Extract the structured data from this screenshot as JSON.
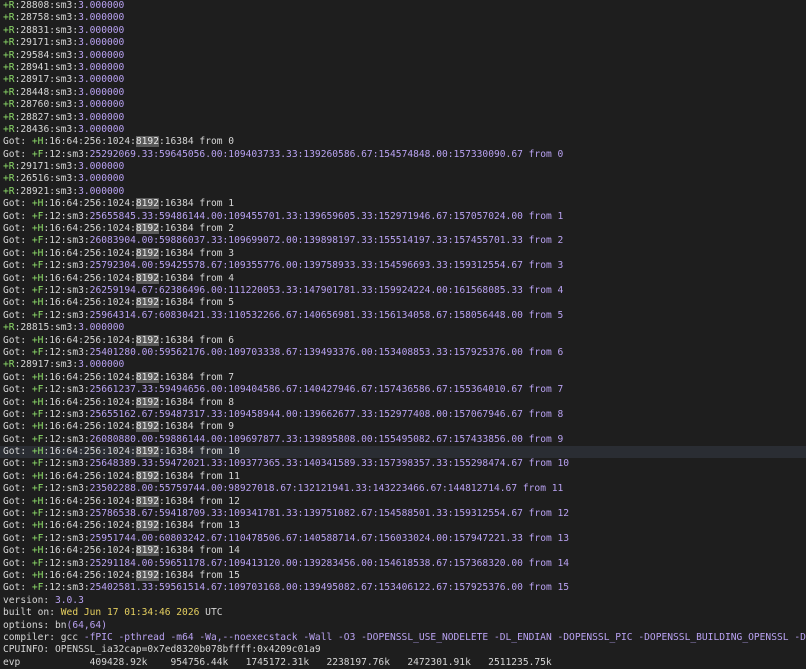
{
  "terminal": {
    "lines": [
      [
        [
          "g",
          "+R"
        ],
        [
          "w",
          ":28808:sm3:"
        ],
        [
          "p",
          "3.000000"
        ]
      ],
      [
        [
          "g",
          "+R"
        ],
        [
          "w",
          ":28758:sm3:"
        ],
        [
          "p",
          "3.000000"
        ]
      ],
      [
        [
          "g",
          "+R"
        ],
        [
          "w",
          ":28831:sm3:"
        ],
        [
          "p",
          "3.000000"
        ]
      ],
      [
        [
          "g",
          "+R"
        ],
        [
          "w",
          ":29171:sm3:"
        ],
        [
          "p",
          "3.000000"
        ]
      ],
      [
        [
          "g",
          "+R"
        ],
        [
          "w",
          ":29584:sm3:"
        ],
        [
          "p",
          "3.000000"
        ]
      ],
      [
        [
          "g",
          "+R"
        ],
        [
          "w",
          ":28941:sm3:"
        ],
        [
          "p",
          "3.000000"
        ]
      ],
      [
        [
          "g",
          "+R"
        ],
        [
          "w",
          ":28917:sm3:"
        ],
        [
          "p",
          "3.000000"
        ]
      ],
      [
        [
          "g",
          "+R"
        ],
        [
          "w",
          ":28448:sm3:"
        ],
        [
          "p",
          "3.000000"
        ]
      ],
      [
        [
          "g",
          "+R"
        ],
        [
          "w",
          ":28760:sm3:"
        ],
        [
          "p",
          "3.000000"
        ]
      ],
      [
        [
          "g",
          "+R"
        ],
        [
          "w",
          ":28827:sm3:"
        ],
        [
          "p",
          "3.000000"
        ]
      ],
      [
        [
          "g",
          "+R"
        ],
        [
          "w",
          ":28436:sm3:"
        ],
        [
          "p",
          "3.000000"
        ]
      ],
      [
        [
          "w",
          "Got: "
        ],
        [
          "g",
          "+H"
        ],
        [
          "w",
          ":16:64:256:1024:"
        ],
        [
          "s",
          "8192"
        ],
        [
          "w",
          ":16384 from 0"
        ]
      ],
      [
        [
          "w",
          "Got: "
        ],
        [
          "g",
          "+F"
        ],
        [
          "w",
          ":12:sm3:"
        ],
        [
          "p",
          "25292069.33:59645056.00:109403733.33:139260586.67:154574848.00:157330090.67 from 0"
        ]
      ],
      [
        [
          "g",
          "+R"
        ],
        [
          "w",
          ":29171:sm3:"
        ],
        [
          "p",
          "3.000000"
        ]
      ],
      [
        [
          "g",
          "+R"
        ],
        [
          "w",
          ":26516:sm3:"
        ],
        [
          "p",
          "3.000000"
        ]
      ],
      [
        [
          "g",
          "+R"
        ],
        [
          "w",
          ":28921:sm3:"
        ],
        [
          "p",
          "3.000000"
        ]
      ],
      [
        [
          "w",
          "Got: "
        ],
        [
          "g",
          "+H"
        ],
        [
          "w",
          ":16:64:256:1024:"
        ],
        [
          "s",
          "8192"
        ],
        [
          "w",
          ":16384 from 1"
        ]
      ],
      [
        [
          "w",
          "Got: "
        ],
        [
          "g",
          "+F"
        ],
        [
          "w",
          ":12:sm3:"
        ],
        [
          "p",
          "25655845.33:59486144.00:109455701.33:139659605.33:152971946.67:157057024.00 from 1"
        ]
      ],
      [
        [
          "w",
          "Got: "
        ],
        [
          "g",
          "+H"
        ],
        [
          "w",
          ":16:64:256:1024:"
        ],
        [
          "s",
          "8192"
        ],
        [
          "w",
          ":16384 from 2"
        ]
      ],
      [
        [
          "w",
          "Got: "
        ],
        [
          "g",
          "+F"
        ],
        [
          "w",
          ":12:sm3:"
        ],
        [
          "p",
          "26083904.00:59886037.33:109699072.00:139898197.33:155514197.33:157455701.33 from 2"
        ]
      ],
      [
        [
          "w",
          "Got: "
        ],
        [
          "g",
          "+H"
        ],
        [
          "w",
          ":16:64:256:1024:"
        ],
        [
          "s",
          "8192"
        ],
        [
          "w",
          ":16384 from 3"
        ]
      ],
      [
        [
          "w",
          "Got: "
        ],
        [
          "g",
          "+F"
        ],
        [
          "w",
          ":12:sm3:"
        ],
        [
          "p",
          "25792304.00:59425578.67:109355776.00:139758933.33:154596693.33:159312554.67 from 3"
        ]
      ],
      [
        [
          "w",
          "Got: "
        ],
        [
          "g",
          "+H"
        ],
        [
          "w",
          ":16:64:256:1024:"
        ],
        [
          "s",
          "8192"
        ],
        [
          "w",
          ":16384 from 4"
        ]
      ],
      [
        [
          "w",
          "Got: "
        ],
        [
          "g",
          "+F"
        ],
        [
          "w",
          ":12:sm3:"
        ],
        [
          "p",
          "26259194.67:62386496.00:111220053.33:147901781.33:159924224.00:161568085.33 from 4"
        ]
      ],
      [
        [
          "w",
          "Got: "
        ],
        [
          "g",
          "+H"
        ],
        [
          "w",
          ":16:64:256:1024:"
        ],
        [
          "s",
          "8192"
        ],
        [
          "w",
          ":16384 from 5"
        ]
      ],
      [
        [
          "w",
          "Got: "
        ],
        [
          "g",
          "+F"
        ],
        [
          "w",
          ":12:sm3:"
        ],
        [
          "p",
          "25964314.67:60830421.33:110532266.67:140656981.33:156134058.67:158056448.00 from 5"
        ]
      ],
      [
        [
          "g",
          "+R"
        ],
        [
          "w",
          ":28815:sm3:"
        ],
        [
          "p",
          "3.000000"
        ]
      ],
      [
        [
          "w",
          "Got: "
        ],
        [
          "g",
          "+H"
        ],
        [
          "w",
          ":16:64:256:1024:"
        ],
        [
          "s",
          "8192"
        ],
        [
          "w",
          ":16384 from 6"
        ]
      ],
      [
        [
          "w",
          "Got: "
        ],
        [
          "g",
          "+F"
        ],
        [
          "w",
          ":12:sm3:"
        ],
        [
          "p",
          "25401280.00:59562176.00:109703338.67:139493376.00:153408853.33:157925376.00 from 6"
        ]
      ],
      [
        [
          "g",
          "+R"
        ],
        [
          "w",
          ":28917:sm3:"
        ],
        [
          "p",
          "3.000000"
        ]
      ],
      [
        [
          "w",
          "Got: "
        ],
        [
          "g",
          "+H"
        ],
        [
          "w",
          ":16:64:256:1024:"
        ],
        [
          "s",
          "8192"
        ],
        [
          "w",
          ":16384 from 7"
        ]
      ],
      [
        [
          "w",
          "Got: "
        ],
        [
          "g",
          "+F"
        ],
        [
          "w",
          ":12:sm3:"
        ],
        [
          "p",
          "25661237.33:59494656.00:109404586.67:140427946.67:157436586.67:155364010.67 from 7"
        ]
      ],
      [
        [
          "w",
          "Got: "
        ],
        [
          "g",
          "+H"
        ],
        [
          "w",
          ":16:64:256:1024:"
        ],
        [
          "s",
          "8192"
        ],
        [
          "w",
          ":16384 from 8"
        ]
      ],
      [
        [
          "w",
          "Got: "
        ],
        [
          "g",
          "+F"
        ],
        [
          "w",
          ":12:sm3:"
        ],
        [
          "p",
          "25655162.67:59487317.33:109458944.00:139662677.33:152977408.00:157067946.67 from 8"
        ]
      ],
      [
        [
          "w",
          "Got: "
        ],
        [
          "g",
          "+H"
        ],
        [
          "w",
          ":16:64:256:1024:"
        ],
        [
          "s",
          "8192"
        ],
        [
          "w",
          ":16384 from 9"
        ]
      ],
      [
        [
          "w",
          "Got: "
        ],
        [
          "g",
          "+F"
        ],
        [
          "w",
          ":12:sm3:"
        ],
        [
          "p",
          "26080880.00:59886144.00:109697877.33:139895808.00:155495082.67:157433856.00 from 9"
        ]
      ],
      [
        [
          "w",
          "Got: "
        ],
        [
          "g",
          "+H"
        ],
        [
          "w",
          ":16:64:256:1024:"
        ],
        [
          "s",
          "8192"
        ],
        [
          "w",
          ":16384 from 10"
        ]
      ],
      [
        [
          "w",
          "Got: "
        ],
        [
          "g",
          "+F"
        ],
        [
          "w",
          ":12:sm3:"
        ],
        [
          "p",
          "25648389.33:59472021.33:109377365.33:140341589.33:157398357.33:155298474.67 from 10"
        ]
      ],
      [
        [
          "w",
          "Got: "
        ],
        [
          "g",
          "+H"
        ],
        [
          "w",
          ":16:64:256:1024:"
        ],
        [
          "s",
          "8192"
        ],
        [
          "w",
          ":16384 from 11"
        ]
      ],
      [
        [
          "w",
          "Got: "
        ],
        [
          "g",
          "+F"
        ],
        [
          "w",
          ":12:sm3:"
        ],
        [
          "p",
          "23502288.00:55759744.00:98927018.67:132121941.33:143223466.67:144812714.67 from 11"
        ]
      ],
      [
        [
          "w",
          "Got: "
        ],
        [
          "g",
          "+H"
        ],
        [
          "w",
          ":16:64:256:1024:"
        ],
        [
          "s",
          "8192"
        ],
        [
          "w",
          ":16384 from 12"
        ]
      ],
      [
        [
          "w",
          "Got: "
        ],
        [
          "g",
          "+F"
        ],
        [
          "w",
          ":12:sm3:"
        ],
        [
          "p",
          "25786538.67:59418709.33:109341781.33:139751082.67:154588501.33:159312554.67 from 12"
        ]
      ],
      [
        [
          "w",
          "Got: "
        ],
        [
          "g",
          "+H"
        ],
        [
          "w",
          ":16:64:256:1024:"
        ],
        [
          "s",
          "8192"
        ],
        [
          "w",
          ":16384 from 13"
        ]
      ],
      [
        [
          "w",
          "Got: "
        ],
        [
          "g",
          "+F"
        ],
        [
          "w",
          ":12:sm3:"
        ],
        [
          "p",
          "25951744.00:60803242.67:110478506.67:140588714.67:156033024.00:157947221.33 from 13"
        ]
      ],
      [
        [
          "w",
          "Got: "
        ],
        [
          "g",
          "+H"
        ],
        [
          "w",
          ":16:64:256:1024:"
        ],
        [
          "s",
          "8192"
        ],
        [
          "w",
          ":16384 from 14"
        ]
      ],
      [
        [
          "w",
          "Got: "
        ],
        [
          "g",
          "+F"
        ],
        [
          "w",
          ":12:sm3:"
        ],
        [
          "p",
          "25291184.00:59651178.67:109413120.00:139283456.00:154618538.67:157368320.00 from 14"
        ]
      ],
      [
        [
          "w",
          "Got: "
        ],
        [
          "g",
          "+H"
        ],
        [
          "w",
          ":16:64:256:1024:"
        ],
        [
          "s",
          "8192"
        ],
        [
          "w",
          ":16384 from 15"
        ]
      ],
      [
        [
          "w",
          "Got: "
        ],
        [
          "g",
          "+F"
        ],
        [
          "w",
          ":12:sm3:"
        ],
        [
          "p",
          "25402581.33:59561514.67:109703168.00:139495082.67:153406122.67:157925376.00 from 15"
        ]
      ],
      [
        [
          "w",
          "version: "
        ],
        [
          "p",
          "3.0.3"
        ]
      ],
      [
        [
          "w",
          "built on: "
        ],
        [
          "y",
          "Wed Jun 17 01:34:46 2026"
        ],
        [
          "w",
          " UTC"
        ]
      ],
      [
        [
          "w",
          "options: "
        ],
        [
          "w",
          "bn"
        ],
        [
          "p",
          "(64,64)"
        ]
      ],
      [
        [
          "w",
          "compiler: gcc "
        ],
        [
          "p",
          "-fPIC -pthread -m64 -Wa,--noexecstack -Wall -O3 -DOPENSSL_USE_NODELETE -DL_ENDIAN -DOPENSSL_PIC -DOPENSSL_BUILDING_OPENSSL -DNDEBUG"
        ]
      ],
      [
        [
          "w",
          "CPUINFO: OPENSSL_ia32cap="
        ],
        [
          "w",
          "0x7ed8320b078bffff:0x4209c01a9"
        ]
      ],
      [
        [
          "w",
          "evp            409428.92k    954756.44k   1745172.31k   2238197.76k   2472301.91k   2511235.75k"
        ]
      ]
    ],
    "highlight_line": 36
  }
}
